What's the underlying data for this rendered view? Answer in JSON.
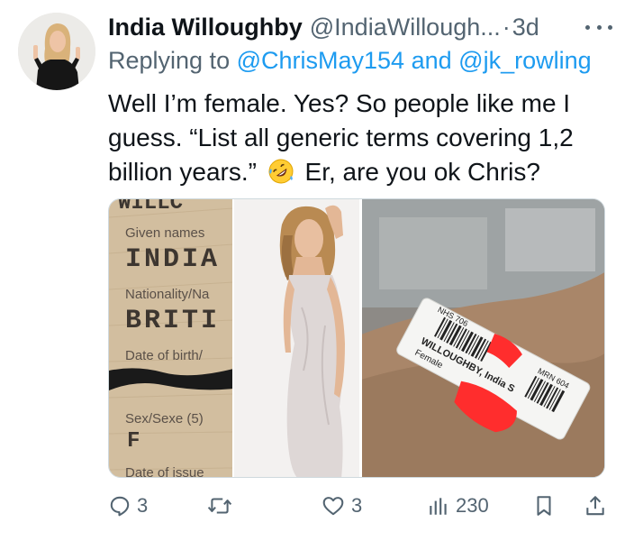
{
  "tweet": {
    "display_name": "India Willoughby",
    "handle": "@IndiaWillough...",
    "separator": "·",
    "time": "3d",
    "reply_prefix": "Replying to",
    "reply_mention_1": "@ChrisMay154",
    "reply_and": "and",
    "reply_mention_2": "@jk_rowling",
    "text_before_emoji": "Well I’m female. Yes? So people like me I guess. “List all generic terms covering 1,2 billion years.”",
    "text_after_emoji": "Er, are you ok Chris?"
  },
  "media": {
    "passport": {
      "surname_partial": "WILLC",
      "given_names_label": "Given names",
      "given_name_value": "INDIA",
      "nationality_label": "Nationality/Na",
      "nationality_value": "BRITI",
      "dob_label": "Date of birth/",
      "sex_label": "Sex/Sexe (5)",
      "sex_value": "F",
      "issue_label": "Date of issue"
    },
    "wristband": {
      "nhs": "NHS 706",
      "name": "WILLOUGHBY, India S",
      "gender": "Female",
      "mrn": "MRN 604"
    }
  },
  "actions": {
    "reply_count": "3",
    "retweet_count": "",
    "like_count": "3",
    "views_count": "230"
  },
  "icons": {
    "reply": "reply-icon",
    "retweet": "retweet-icon",
    "like": "like-icon",
    "views": "views-icon",
    "bookmark": "bookmark-icon",
    "share": "share-icon",
    "more": "more-icon",
    "emoji": "rolling-on-floor-laughing-emoji"
  },
  "colors": {
    "text": "#0f1419",
    "secondary": "#536471",
    "link": "#1d9bf0"
  }
}
